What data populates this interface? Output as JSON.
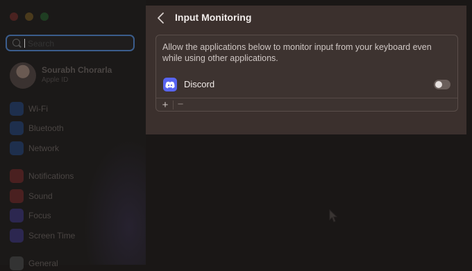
{
  "window": {
    "traffic_lights": {
      "close": "#ff5f57",
      "minimize": "#febc2e",
      "zoom": "#28c840"
    }
  },
  "sidebar": {
    "search": {
      "placeholder": "Search"
    },
    "profile": {
      "name": "Sourabh Chorarla",
      "subtitle": "Apple ID"
    },
    "items": [
      {
        "label": "Wi-Fi",
        "icon": "wifi-icon",
        "color": "#2b6de0"
      },
      {
        "label": "Bluetooth",
        "icon": "bluetooth-icon",
        "color": "#2b6de0"
      },
      {
        "label": "Network",
        "icon": "globe-icon",
        "color": "#2b6de0"
      },
      {
        "label": "Notifications",
        "icon": "bell-icon",
        "color": "#e0393e"
      },
      {
        "label": "Sound",
        "icon": "speaker-icon",
        "color": "#e0393e"
      },
      {
        "label": "Focus",
        "icon": "moon-icon",
        "color": "#5b4ed0"
      },
      {
        "label": "Screen Time",
        "icon": "hourglass-icon",
        "color": "#5b4ed0"
      },
      {
        "label": "General",
        "icon": "gear-icon",
        "color": "#888888"
      }
    ]
  },
  "panel": {
    "title": "Input Monitoring",
    "description": "Allow the applications below to monitor input from your keyboard even while using other applications.",
    "apps": [
      {
        "name": "Discord",
        "icon": "discord-icon",
        "enabled": false,
        "color": "#5865f2"
      }
    ],
    "add_label": "+",
    "remove_label": "−"
  }
}
